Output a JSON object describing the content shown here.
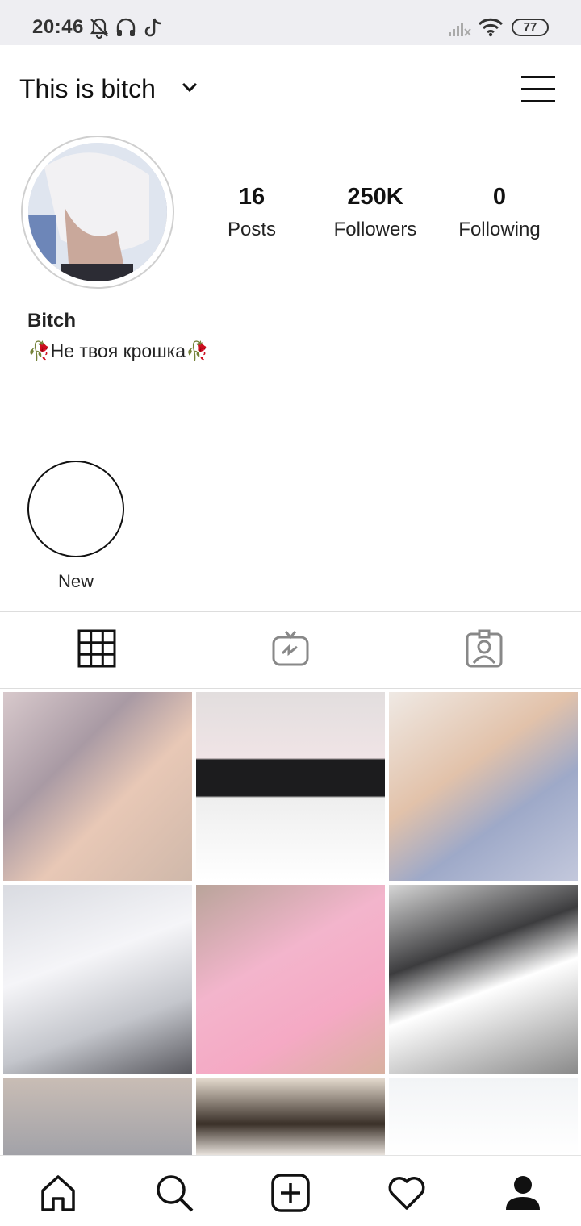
{
  "status_bar": {
    "time": "20:46",
    "battery": "77",
    "icons": [
      "bell-off-icon",
      "headphones-icon",
      "tiktok-icon",
      "signal-icon",
      "wifi-icon",
      "battery-icon"
    ]
  },
  "header": {
    "username": "This is bitch",
    "icons": [
      "chevron-down-icon",
      "menu-icon"
    ]
  },
  "profile": {
    "stats": [
      {
        "value": "16",
        "label": "Posts"
      },
      {
        "value": "250K",
        "label": "Followers"
      },
      {
        "value": "0",
        "label": "Following"
      }
    ],
    "name": "Bitch",
    "bio": "Не твоя крошка",
    "bio_emoji": "🥀"
  },
  "highlights": [
    {
      "label": "New"
    }
  ],
  "tabs": [
    {
      "icon": "grid-icon",
      "active": true
    },
    {
      "icon": "igtv-icon",
      "active": false
    },
    {
      "icon": "tagged-icon",
      "active": false
    }
  ],
  "bottom_nav": [
    "home-icon",
    "search-icon",
    "add-post-icon",
    "heart-icon",
    "profile-icon"
  ],
  "colors": {
    "status_bar_bg": "#eeeef2",
    "text": "#111111",
    "divider": "#dddddd"
  }
}
